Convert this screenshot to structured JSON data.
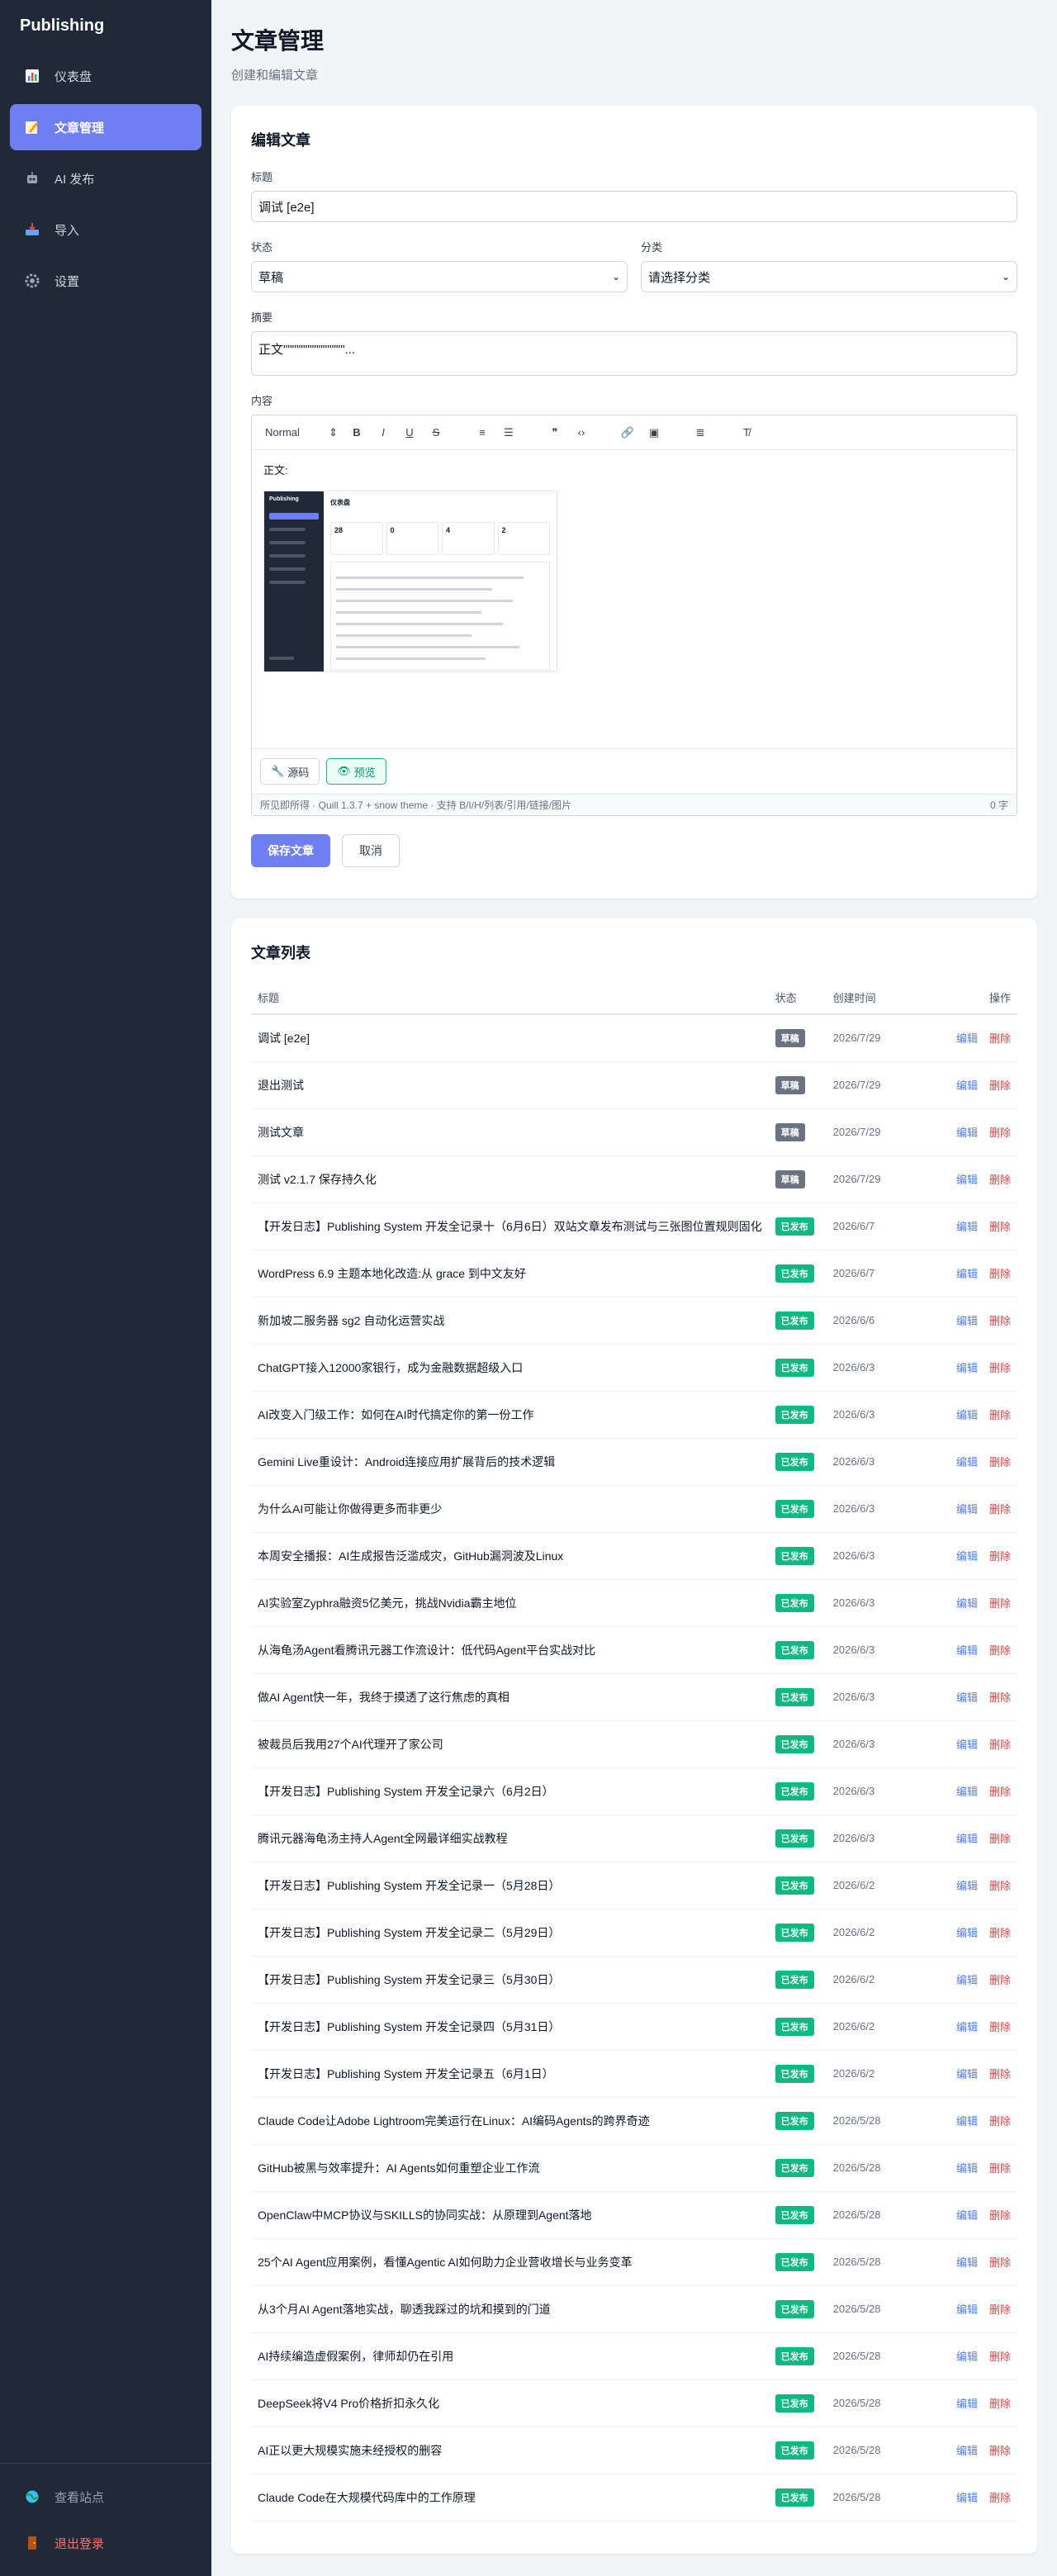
{
  "sidebar": {
    "brand": "Publishing",
    "items": [
      {
        "label": "仪表盘",
        "icon": "chart-icon"
      },
      {
        "label": "文章管理",
        "icon": "pencil-icon"
      },
      {
        "label": "AI 发布",
        "icon": "robot-icon"
      },
      {
        "label": "导入",
        "icon": "inbox-icon"
      },
      {
        "label": "设置",
        "icon": "gear-icon"
      }
    ],
    "bottom": {
      "view_site": "查看站点",
      "logout": "退出登录"
    }
  },
  "page": {
    "title": "文章管理",
    "subtitle": "创建和编辑文章"
  },
  "editor": {
    "card_title": "编辑文章",
    "title_label": "标题",
    "title_value": "调试 [e2e]",
    "status_label": "状态",
    "status_value": "草稿",
    "category_label": "分类",
    "category_value": "请选择分类",
    "summary_label": "摘要",
    "summary_value": "正文\"\"\"\"\"\"\"\"\"\"\"\"\"\"...",
    "content_label": "内容",
    "toolbar_format": "Normal",
    "content_text": "正文:",
    "thumb": {
      "brand": "Publishing",
      "title": "仪表盘",
      "stats": [
        "28",
        "0",
        "4",
        "2"
      ]
    },
    "source_button": "源码",
    "preview_button": "预览",
    "footer_info": "所见即所得 · Quill 1.3.7 + snow theme · 支持 B/I/H/列表/引用/链接/图片",
    "word_count": "0 字",
    "save_button": "保存文章",
    "cancel_button": "取消"
  },
  "list": {
    "card_title": "文章列表",
    "columns": {
      "title": "标题",
      "status": "状态",
      "created": "创建时间",
      "actions": "操作"
    },
    "edit_label": "编辑",
    "delete_label": "删除",
    "rows": [
      {
        "title": "调试 [e2e]",
        "status": "草稿",
        "type": "draft",
        "date": "2026/7/29"
      },
      {
        "title": "退出测试",
        "status": "草稿",
        "type": "draft",
        "date": "2026/7/29"
      },
      {
        "title": "测试文章",
        "status": "草稿",
        "type": "draft",
        "date": "2026/7/29"
      },
      {
        "title": "测试 v2.1.7 保存持久化",
        "status": "草稿",
        "type": "draft",
        "date": "2026/7/29"
      },
      {
        "title": "【开发日志】Publishing System 开发全记录十（6月6日）双站文章发布测试与三张图位置规则固化",
        "status": "已发布",
        "type": "published",
        "date": "2026/6/7"
      },
      {
        "title": "WordPress 6.9 主题本地化改造:从 grace 到中文友好",
        "status": "已发布",
        "type": "published",
        "date": "2026/6/7"
      },
      {
        "title": "新加坡二服务器 sg2 自动化运营实战",
        "status": "已发布",
        "type": "published",
        "date": "2026/6/6"
      },
      {
        "title": "ChatGPT接入12000家银行，成为金融数据超级入口",
        "status": "已发布",
        "type": "published",
        "date": "2026/6/3"
      },
      {
        "title": "AI改变入门级工作：如何在AI时代搞定你的第一份工作",
        "status": "已发布",
        "type": "published",
        "date": "2026/6/3"
      },
      {
        "title": "Gemini Live重设计：Android连接应用扩展背后的技术逻辑",
        "status": "已发布",
        "type": "published",
        "date": "2026/6/3"
      },
      {
        "title": "为什么AI可能让你做得更多而非更少",
        "status": "已发布",
        "type": "published",
        "date": "2026/6/3"
      },
      {
        "title": "本周安全播报：AI生成报告泛滥成灾，GitHub漏洞波及Linux",
        "status": "已发布",
        "type": "published",
        "date": "2026/6/3"
      },
      {
        "title": "AI实验室Zyphra融资5亿美元，挑战Nvidia霸主地位",
        "status": "已发布",
        "type": "published",
        "date": "2026/6/3"
      },
      {
        "title": "从海龟汤Agent看腾讯元器工作流设计：低代码Agent平台实战对比",
        "status": "已发布",
        "type": "published",
        "date": "2026/6/3"
      },
      {
        "title": "做AI Agent快一年，我终于摸透了这行焦虑的真相",
        "status": "已发布",
        "type": "published",
        "date": "2026/6/3"
      },
      {
        "title": "被裁员后我用27个AI代理开了家公司",
        "status": "已发布",
        "type": "published",
        "date": "2026/6/3"
      },
      {
        "title": "【开发日志】Publishing System 开发全记录六（6月2日）",
        "status": "已发布",
        "type": "published",
        "date": "2026/6/3"
      },
      {
        "title": "腾讯元器海龟汤主持人Agent全网最详细实战教程",
        "status": "已发布",
        "type": "published",
        "date": "2026/6/3"
      },
      {
        "title": "【开发日志】Publishing System 开发全记录一（5月28日）",
        "status": "已发布",
        "type": "published",
        "date": "2026/6/2"
      },
      {
        "title": "【开发日志】Publishing System 开发全记录二（5月29日）",
        "status": "已发布",
        "type": "published",
        "date": "2026/6/2"
      },
      {
        "title": "【开发日志】Publishing System 开发全记录三（5月30日）",
        "status": "已发布",
        "type": "published",
        "date": "2026/6/2"
      },
      {
        "title": "【开发日志】Publishing System 开发全记录四（5月31日）",
        "status": "已发布",
        "type": "published",
        "date": "2026/6/2"
      },
      {
        "title": "【开发日志】Publishing System 开发全记录五（6月1日）",
        "status": "已发布",
        "type": "published",
        "date": "2026/6/2"
      },
      {
        "title": "Claude Code让Adobe Lightroom完美运行在Linux：AI编码Agents的跨界奇迹",
        "status": "已发布",
        "type": "published",
        "date": "2026/5/28"
      },
      {
        "title": "GitHub被黑与效率提升：AI Agents如何重塑企业工作流",
        "status": "已发布",
        "type": "published",
        "date": "2026/5/28"
      },
      {
        "title": "OpenClaw中MCP协议与SKILLS的协同实战：从原理到Agent落地",
        "status": "已发布",
        "type": "published",
        "date": "2026/5/28"
      },
      {
        "title": "25个AI Agent应用案例，看懂Agentic AI如何助力企业营收增长与业务变革",
        "status": "已发布",
        "type": "published",
        "date": "2026/5/28"
      },
      {
        "title": "从3个月AI Agent落地实战，聊透我踩过的坑和摸到的门道",
        "status": "已发布",
        "type": "published",
        "date": "2026/5/28"
      },
      {
        "title": "AI持续编造虚假案例，律师却仍在引用",
        "status": "已发布",
        "type": "published",
        "date": "2026/5/28"
      },
      {
        "title": "DeepSeek将V4 Pro价格折扣永久化",
        "status": "已发布",
        "type": "published",
        "date": "2026/5/28"
      },
      {
        "title": "AI正以更大规模实施未经授权的删容",
        "status": "已发布",
        "type": "published",
        "date": "2026/5/28"
      },
      {
        "title": "Claude Code在大规模代码库中的工作原理",
        "status": "已发布",
        "type": "published",
        "date": "2026/5/28"
      }
    ]
  }
}
